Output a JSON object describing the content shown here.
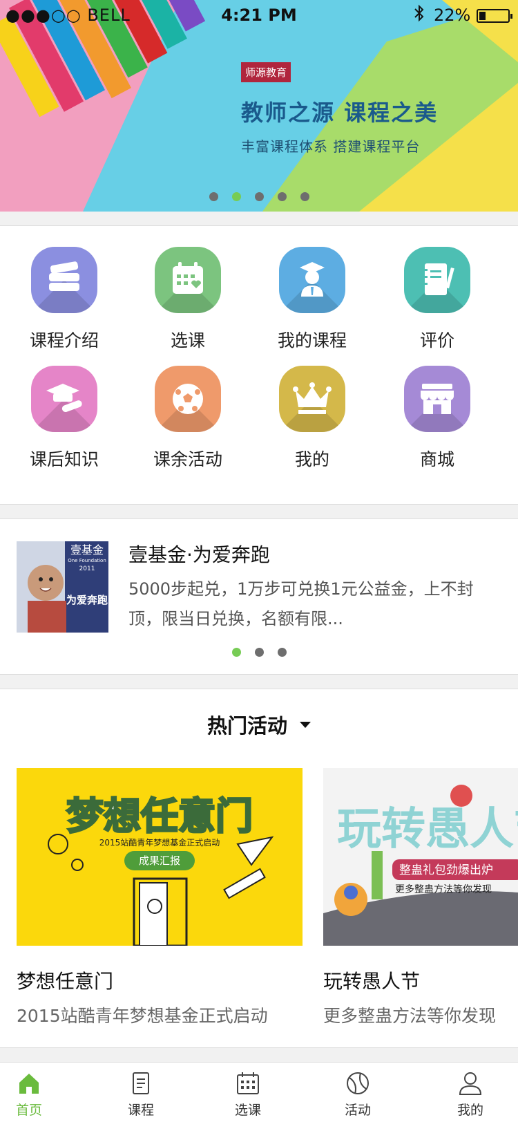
{
  "status_bar": {
    "carrier": "●●●○○ BELL",
    "time": "4:21 PM",
    "battery": "22%"
  },
  "banner": {
    "tag": "师源教育",
    "title": "教师之源  课程之美",
    "subtitle": "丰富课程体系 搭建课程平台",
    "dots": 5,
    "active_dot": 1
  },
  "grid": [
    {
      "label": "课程介绍",
      "icon": "books-icon",
      "color": "#8b8fe0"
    },
    {
      "label": "选课",
      "icon": "calendar-heart-icon",
      "color": "#7cc47f"
    },
    {
      "label": "我的课程",
      "icon": "graduate-icon",
      "color": "#5dade2"
    },
    {
      "label": "评价",
      "icon": "notebook-pen-icon",
      "color": "#4dbfb3"
    },
    {
      "label": "课后知识",
      "icon": "mortarboard-diploma-icon",
      "color": "#e585c8"
    },
    {
      "label": "课余活动",
      "icon": "soccer-ball-icon",
      "color": "#ef9a6b"
    },
    {
      "label": "我的",
      "icon": "crown-icon",
      "color": "#d4b84a"
    },
    {
      "label": "商城",
      "icon": "shop-icon",
      "color": "#a58ad6"
    }
  ],
  "feature": {
    "title": "壹基金·为爱奔跑",
    "description": "5000步起兑，1万步可兑换1元公益金，上不封顶，限当日兑换，名额有限...",
    "dots": 3,
    "active_dot": 0,
    "thumb_text": {
      "brand": "壹基金",
      "year": "2011",
      "en": "One Foundation",
      "slogan": "为爱奔跑"
    }
  },
  "hot": {
    "title": "热门活动",
    "cards": [
      {
        "title": "梦想任意门",
        "subtitle": "2015站酷青年梦想基金正式启动",
        "image_text": {
          "headline": "梦想任意门",
          "sub": "2015站酷青年梦想基金正式启动",
          "button": "成果汇报"
        }
      },
      {
        "title": "玩转愚人节",
        "subtitle": "更多整蛊方法等你发现",
        "image_text": {
          "headline": "玩转愚人节",
          "banner": "整蛊礼包劲爆出炉",
          "sub": "更多整蛊方法等你发现"
        }
      }
    ]
  },
  "tabbar": [
    {
      "label": "首页",
      "icon": "home-icon",
      "active": true
    },
    {
      "label": "课程",
      "icon": "document-icon",
      "active": false
    },
    {
      "label": "选课",
      "icon": "calendar-icon",
      "active": false
    },
    {
      "label": "活动",
      "icon": "ball-icon",
      "active": false
    },
    {
      "label": "我的",
      "icon": "user-icon",
      "active": false
    }
  ],
  "colors": {
    "accent": "#6abb3d",
    "dot_active": "#77cc55",
    "dot": "#6e6e6e",
    "tag": "#b0263d"
  }
}
